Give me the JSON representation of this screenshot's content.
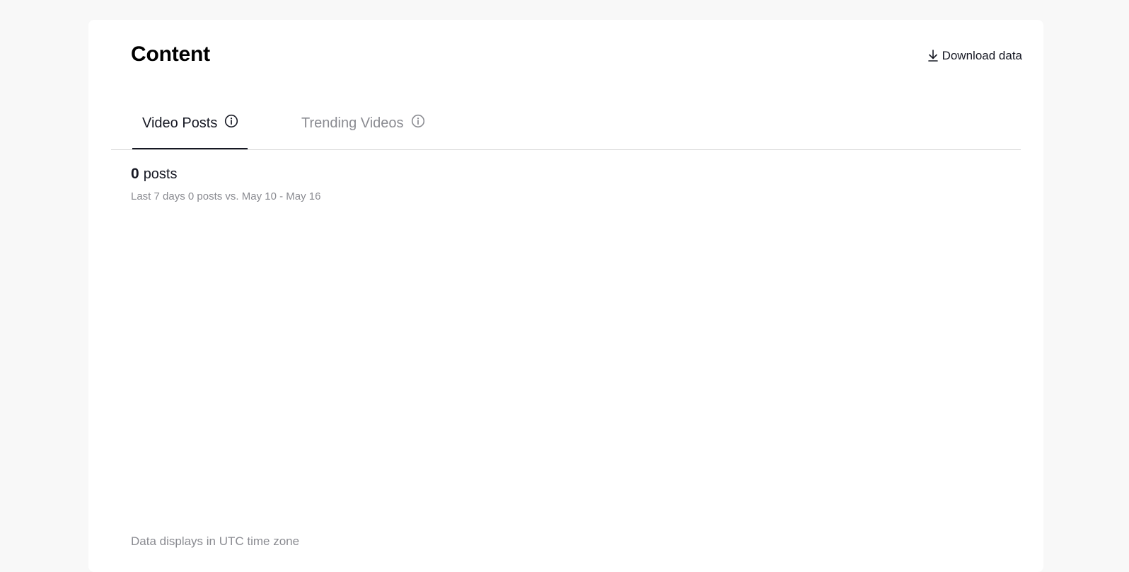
{
  "page": {
    "title": "Content",
    "download_label": "Download data"
  },
  "tabs": [
    {
      "label": "Video Posts",
      "active": true
    },
    {
      "label": "Trending Videos",
      "active": false
    }
  ],
  "summary": {
    "count": "0",
    "count_unit": "posts",
    "comparison": "Last 7 days 0 posts vs. May 10 - May 16"
  },
  "footer": {
    "timezone_note": "Data displays in UTC time zone"
  },
  "icons": {
    "download": "download-icon",
    "info": "info-icon"
  },
  "colors": {
    "text_primary": "#161823",
    "text_secondary": "#8a8b91",
    "background": "#f8f8f8",
    "card": "#ffffff"
  }
}
